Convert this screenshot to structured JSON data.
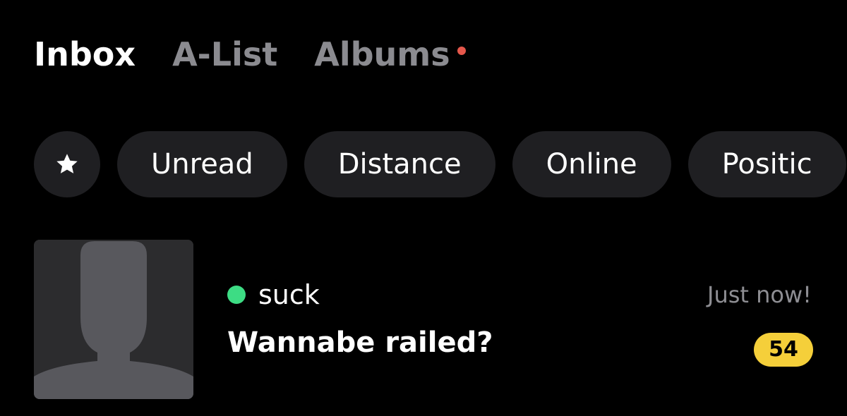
{
  "tabs": [
    {
      "label": "Inbox",
      "active": true
    },
    {
      "label": "A-List",
      "active": false
    },
    {
      "label": "Albums",
      "active": false,
      "has_notification_dot": true
    }
  ],
  "filters": {
    "star_icon": "star-icon",
    "chips": [
      "Unread",
      "Distance",
      "Online",
      "Positic"
    ]
  },
  "conversation": {
    "avatar_icon": "default-profile-silhouette",
    "online": true,
    "name": "suck",
    "message": "Wannabe railed?",
    "timestamp": "Just now!",
    "unread_count": "54"
  },
  "colors": {
    "background": "#000000",
    "chip_background": "#1f1f22",
    "notification_dot": "#e5574b",
    "online_indicator": "#3ddc84",
    "badge": "#f5cf3a",
    "inactive_text": "#8b8b90"
  }
}
